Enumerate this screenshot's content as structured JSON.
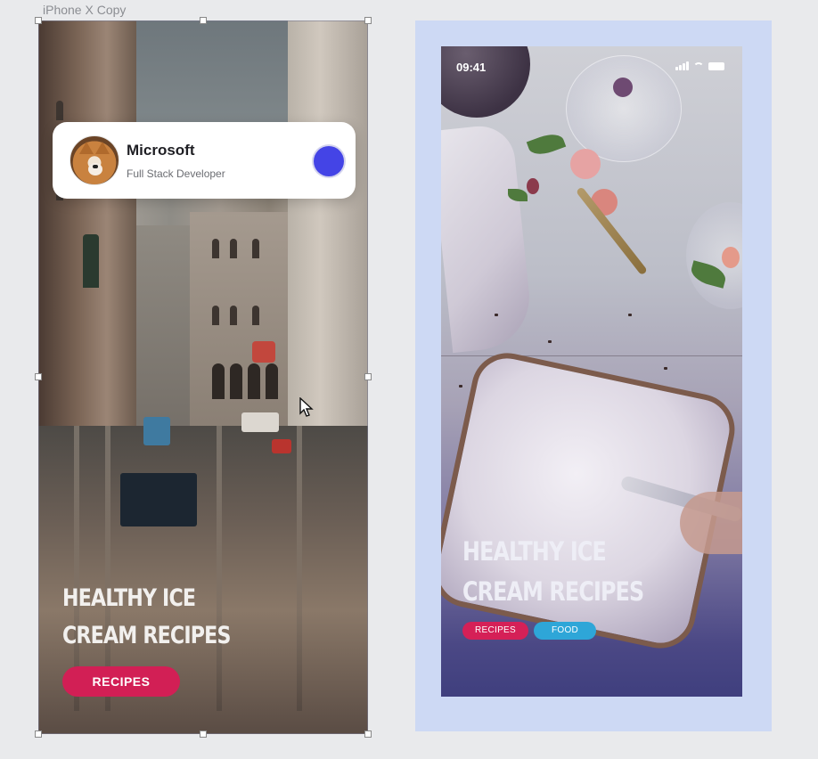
{
  "canvas": {
    "artboard_label": "iPhone X Copy"
  },
  "left_artboard": {
    "profile_card": {
      "company": "Microsoft",
      "role": "Full Stack Developer",
      "avatar": "shiba-dog-avatar",
      "status_dot_color": "#4444e6"
    },
    "headline": "HEALTHY ICE CREAM RECIPES",
    "cta_label": "RECIPES",
    "cta_color": "#d21f55"
  },
  "right_preview": {
    "status_bar": {
      "time": "09:41",
      "icons": [
        "signal-icon",
        "wifi-icon",
        "battery-icon"
      ]
    },
    "headline": "HEALTHY ICE CREAM RECIPES",
    "tags": [
      {
        "label": "RECIPES",
        "color": "#d52057"
      },
      {
        "label": "FOOD",
        "color": "#2ea6d8"
      }
    ],
    "preview_background_color": "#cdd9f4"
  }
}
